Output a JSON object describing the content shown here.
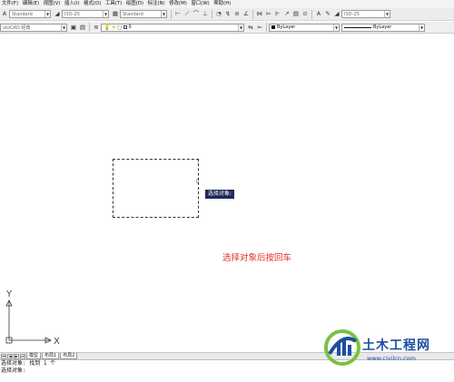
{
  "menu": {
    "items": [
      "文件(F)",
      "编辑(E)",
      "视图(V)",
      "插入(I)",
      "格式(O)",
      "工具(T)",
      "绘图(D)",
      "标注(N)",
      "修改(M)",
      "窗口(W)",
      "帮助(H)"
    ]
  },
  "toolbar1": {
    "text_style": "Standard",
    "dim_style": "ISO-25",
    "table_style": "Standard",
    "dim_style_right": "ISO-25"
  },
  "toolbar2": {
    "workspace": "utoCAD 经典",
    "layer_value": "0",
    "color": "ByLayer",
    "linetype": "ByLayer"
  },
  "canvas": {
    "tooltip": "选择对象:",
    "annotation": "选择对象后按回车",
    "axis_y": "Y",
    "axis_x": "X"
  },
  "tabs": {
    "items": [
      "模型",
      "布局1",
      "布局2"
    ]
  },
  "command": {
    "line1": "选择对象: 找到 1 个",
    "line2": "选择对象:"
  },
  "watermark": {
    "title": "土木工程网",
    "url": "www.civilcn.com"
  },
  "colors": {
    "annotation": "#e0332e",
    "tooltip_bg": "#1f2a5a",
    "watermark_blue": "#1c4fa0",
    "watermark_green": "#7cc142"
  }
}
